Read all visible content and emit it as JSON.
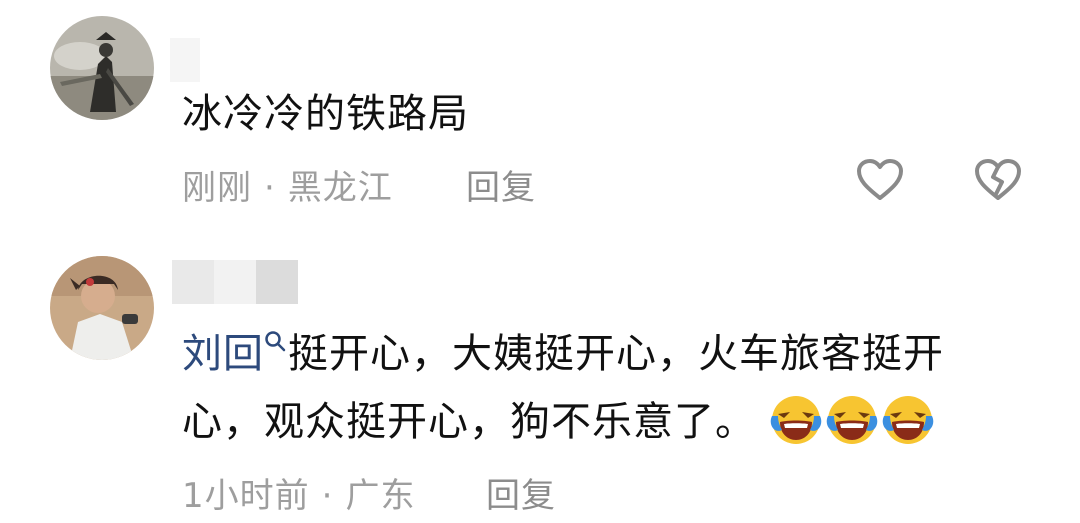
{
  "comments": [
    {
      "text": "冰冷冷的铁路局",
      "time": "刚刚",
      "separator": "·",
      "location": "黑龙江",
      "reply_label": "回复"
    },
    {
      "mention": "刘回",
      "text_line1": "挺开心，大姨挺开心，火车旅客挺开",
      "text_line2": "心，观众挺开心，狗不乐意了。",
      "time": "1小时前",
      "separator": "·",
      "location": "广东",
      "reply_label": "回复"
    }
  ],
  "icons": {
    "like": "heart-outline-icon",
    "dislike": "broken-heart-icon",
    "mention": "search-magnifier-icon",
    "emoji": "laughing-crying-emoji-icon"
  },
  "colors": {
    "text": "#111111",
    "meta": "#9e9e9e",
    "mention": "#2d4a7c",
    "icon": "#8a8a8a"
  }
}
